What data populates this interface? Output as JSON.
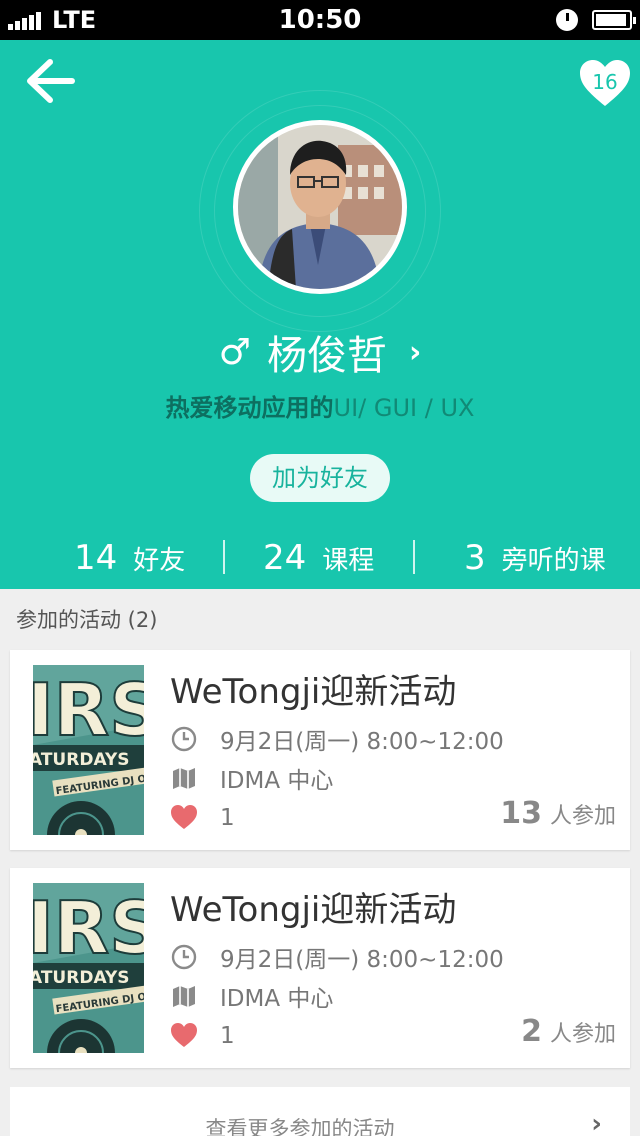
{
  "status_bar": {
    "carrier": "LTE",
    "time": "10:50"
  },
  "header": {
    "favorite_count": "16"
  },
  "profile": {
    "name": "杨俊哲",
    "gender_symbol": "♂",
    "bio_bold": "热爱移动应用的",
    "bio_rest": "UI/ GUI / UX",
    "add_friend_label": "加为好友"
  },
  "stats": [
    {
      "value": "14",
      "label": "好友"
    },
    {
      "value": "24",
      "label": "课程"
    },
    {
      "value": "3",
      "label": "旁听的课"
    }
  ],
  "activities_section": {
    "title": "参加的活动 (2)"
  },
  "activities": [
    {
      "title": "WeTongji迎新活动",
      "time": "9月2日(周一)  8:00~12:00",
      "location": "IDMA 中心",
      "likes": "1",
      "participants": "13",
      "participants_label": "人参加"
    },
    {
      "title": "WeTongji迎新活动",
      "time": "9月2日(周一)  8:00~12:00",
      "location": "IDMA 中心",
      "likes": "1",
      "participants": "2",
      "participants_label": "人参加"
    }
  ],
  "more_link": {
    "label": "查看更多参加的活动"
  },
  "colors": {
    "accent": "#18c6ad",
    "heart": "#e86a6e",
    "background": "#efefef"
  }
}
